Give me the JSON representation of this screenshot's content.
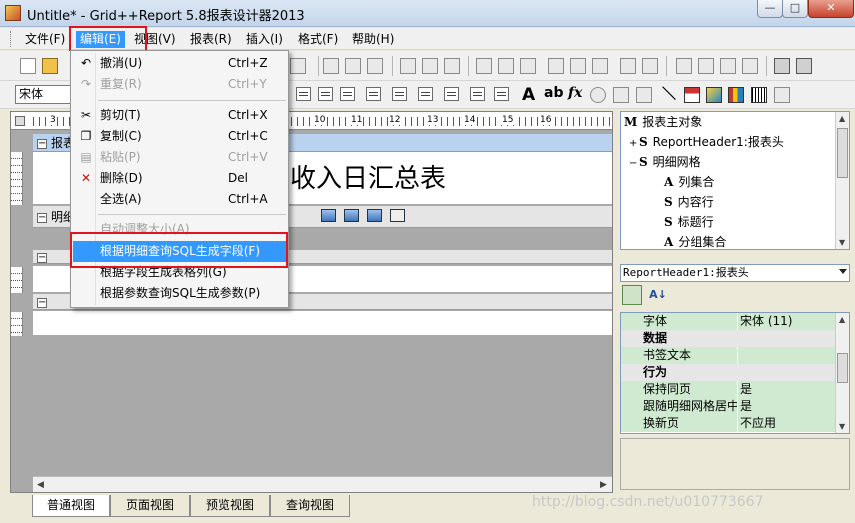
{
  "window": {
    "title": "Untitle* - Grid++Report 5.8报表设计器2013",
    "min_glyph": "—",
    "max_glyph": "□",
    "close_glyph": "✕"
  },
  "menubar": {
    "items": [
      {
        "label": "文件(F)",
        "name": "menu-file"
      },
      {
        "label": "编辑(E)",
        "name": "menu-edit"
      },
      {
        "label": "视图(V)",
        "name": "menu-view"
      },
      {
        "label": "报表(R)",
        "name": "menu-report"
      },
      {
        "label": "插入(I)",
        "name": "menu-insert"
      },
      {
        "label": "格式(F)",
        "name": "menu-format"
      },
      {
        "label": "帮助(H)",
        "name": "menu-help"
      }
    ]
  },
  "toolbar": {
    "font_name": "宋体",
    "glyphs": [
      "A",
      "ab",
      "fx"
    ]
  },
  "edit_menu": {
    "undo": {
      "label": "撤消(U)",
      "shortcut": "Ctrl+Z"
    },
    "redo": {
      "label": "重复(R)",
      "shortcut": "Ctrl+Y"
    },
    "cut": {
      "label": "剪切(T)",
      "shortcut": "Ctrl+X"
    },
    "copy": {
      "label": "复制(C)",
      "shortcut": "Ctrl+C"
    },
    "paste": {
      "label": "粘贴(P)",
      "shortcut": "Ctrl+V"
    },
    "delete": {
      "label": "删除(D)",
      "shortcut": "Del"
    },
    "select_all": {
      "label": "全选(A)",
      "shortcut": "Ctrl+A"
    },
    "auto_size": {
      "label": "自动调整大小(A)"
    },
    "gen_fields": {
      "label": "根据明细查询SQL生成字段(F)"
    },
    "gen_columns": {
      "label": "根据字段生成表格列(G)"
    },
    "gen_params": {
      "label": "根据参数查询SQL生成参数(P)"
    }
  },
  "designer": {
    "ruler_labels": [
      "3",
      "10",
      "11",
      "12",
      "13",
      "14",
      "15",
      "16",
      "17"
    ],
    "report_header": "报表",
    "detail_header": "明细",
    "report_title": "收入日汇总表",
    "collapse_glyph": "−"
  },
  "object_tree": {
    "items": [
      {
        "glyph": "M",
        "label": "报表主对象",
        "indent": 0
      },
      {
        "glyph": "S",
        "label": "ReportHeader1:报表头",
        "indent": 1,
        "expander": "+"
      },
      {
        "glyph": "S",
        "label": "明细网格",
        "indent": 1,
        "expander": "−"
      },
      {
        "glyph": "A",
        "label": "列集合",
        "indent": 2
      },
      {
        "glyph": "S",
        "label": "内容行",
        "indent": 2
      },
      {
        "glyph": "S",
        "label": "标题行",
        "indent": 2
      },
      {
        "glyph": "A",
        "label": "分组集合",
        "indent": 2
      }
    ]
  },
  "property_combo": {
    "value": "ReportHeader1:报表头"
  },
  "properties": {
    "rows": [
      {
        "type": "prop",
        "key": "字体",
        "value": "宋体 (11)"
      },
      {
        "type": "cat",
        "key": "数据"
      },
      {
        "type": "prop",
        "key": "书签文本",
        "value": ""
      },
      {
        "type": "cat",
        "key": "行为"
      },
      {
        "type": "prop",
        "key": "保持同页",
        "value": "是"
      },
      {
        "type": "prop",
        "key": "跟随明细网格居中",
        "value": "是"
      },
      {
        "type": "prop",
        "key": "换新页",
        "value": "不应用"
      }
    ]
  },
  "view_tabs": [
    {
      "label": "普通视图",
      "active": true
    },
    {
      "label": "页面视图",
      "active": false
    },
    {
      "label": "预览视图",
      "active": false
    },
    {
      "label": "查询视图",
      "active": false
    }
  ],
  "watermark": "http://blog.csdn.net/u010773667"
}
